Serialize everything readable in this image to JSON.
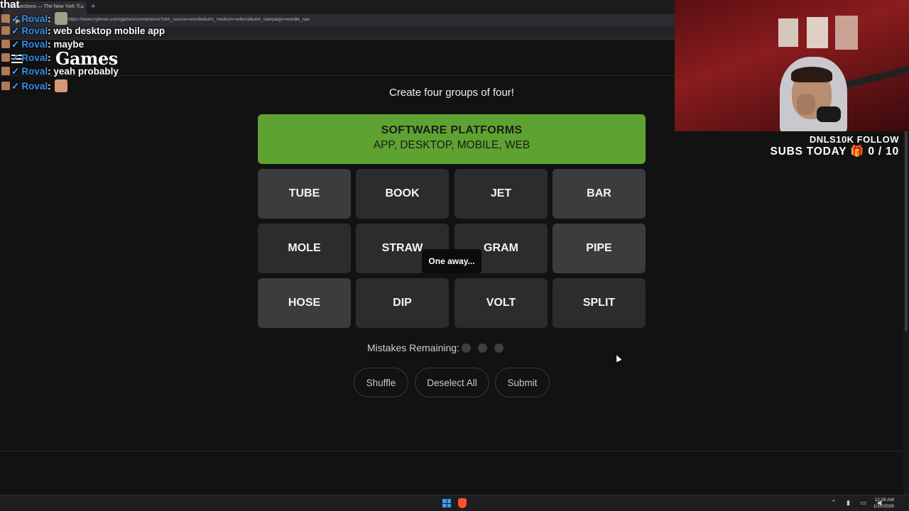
{
  "browser": {
    "tab_title": "Connections — The New York Ti...",
    "tab_close": "×",
    "new_tab": "+",
    "url": "https://www.nytimes.com/games/connections?utm_source=wordle&utm_medium=referral&utm_campaign=wordle_nav"
  },
  "header": {
    "logo_text": "Games"
  },
  "chat": {
    "top_fragment": "that",
    "messages": [
      {
        "user": "Roval",
        "text": ""
      },
      {
        "user": "Roval",
        "text": "web desktop mobile app"
      },
      {
        "user": "Roval",
        "text": "maybe"
      },
      {
        "user": "Roval",
        "text": ""
      },
      {
        "user": "Roval",
        "text": "yeah probably"
      },
      {
        "user": "Roval",
        "text": ""
      }
    ],
    "separator": ":"
  },
  "game": {
    "subtitle": "Create four groups of four!",
    "solved_group": {
      "title": "SOFTWARE PLATFORMS",
      "words": "APP, DESKTOP, MOBILE, WEB",
      "color": "#5ea331"
    },
    "tiles": [
      [
        "TUBE",
        "BOOK",
        "JET",
        "BAR"
      ],
      [
        "MOLE",
        "STRAW",
        "GRAM",
        "PIPE"
      ],
      [
        "HOSE",
        "DIP",
        "VOLT",
        "SPLIT"
      ]
    ],
    "toast": "One away...",
    "mistakes_label": "Mistakes Remaining:",
    "mistakes_remaining": 3,
    "buttons": {
      "shuffle": "Shuffle",
      "deselect": "Deselect All",
      "submit": "Submit"
    }
  },
  "stream_overlay": {
    "follow_goal": "DNLS10K FOLLOW",
    "subs_goal": "SUBS TODAY",
    "gift_icon": "🎁",
    "subs_count": "0 / 10"
  },
  "taskbar": {
    "time": "12:26 AM",
    "date": "1/10/2026"
  }
}
